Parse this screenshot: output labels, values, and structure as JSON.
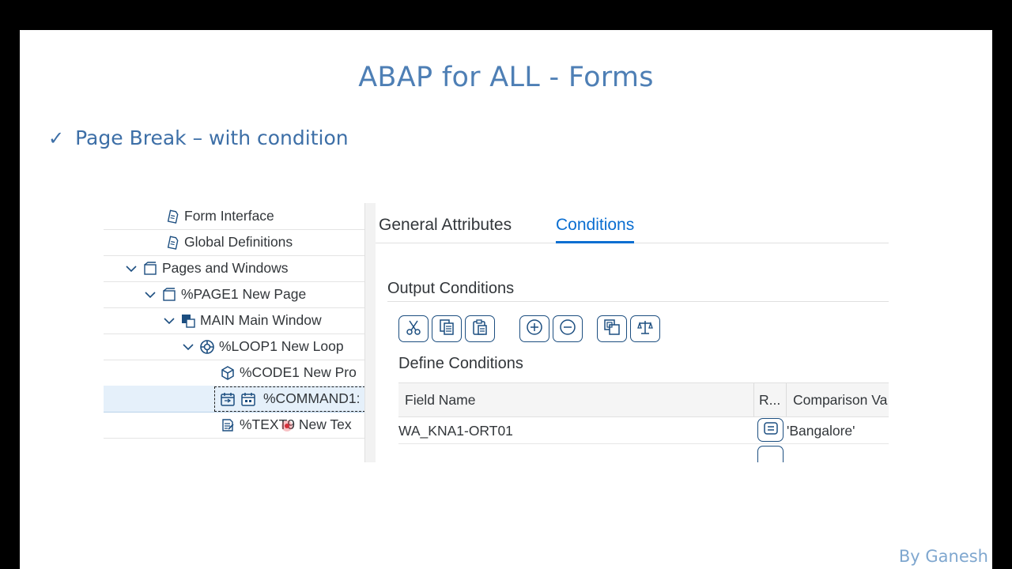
{
  "slide": {
    "title": "ABAP for ALL - Forms",
    "bullet_mark": "✓",
    "bullet_text": "Page Break – with condition",
    "author": "By Ganesh"
  },
  "tree": {
    "items": [
      {
        "label": "Form Interface",
        "icon": "form-interface-icon",
        "expanded": null
      },
      {
        "label": "Global Definitions",
        "icon": "global-definitions-icon",
        "expanded": null
      },
      {
        "label": "Pages and Windows",
        "icon": "pages-windows-icon",
        "expanded": true
      },
      {
        "label": "%PAGE1 New Page",
        "icon": "page-icon",
        "expanded": true
      },
      {
        "label": "MAIN Main Window",
        "icon": "window-icon",
        "expanded": true
      },
      {
        "label": "%LOOP1 New Loop",
        "icon": "loop-icon",
        "expanded": true
      },
      {
        "label": "%CODE1 New Pro",
        "icon": "code-icon",
        "expanded": null
      },
      {
        "label": "%COMMAND1:",
        "icon": "command-icon",
        "expanded": null,
        "selected": true
      },
      {
        "label": "%TEXT9 New Tex",
        "icon": "text-icon",
        "expanded": null
      }
    ]
  },
  "panel": {
    "tabs": [
      {
        "label": "General Attributes",
        "active": false
      },
      {
        "label": "Conditions",
        "active": true
      }
    ],
    "output_conditions_title": "Output Conditions",
    "toolbar": [
      {
        "icon": "cut-icon"
      },
      {
        "icon": "copy-icon"
      },
      {
        "icon": "paste-icon"
      },
      {
        "icon": "add-icon"
      },
      {
        "icon": "remove-icon"
      },
      {
        "icon": "duplicate-icon"
      },
      {
        "icon": "balance-icon"
      }
    ],
    "define_conditions_title": "Define Conditions",
    "grid": {
      "columns": [
        "Field Name",
        "R...",
        "Comparison Va"
      ],
      "rows": [
        {
          "field_name": "WA_KNA1-ORT01",
          "relation_icon": "equals-icon",
          "comparison_value": "'Bangalore'"
        },
        {
          "field_name": "",
          "relation_icon": "",
          "comparison_value": ""
        }
      ]
    }
  },
  "colors": {
    "title": "#4e7fb5",
    "accent": "#0a6ed1",
    "button_border": "#1c4e80",
    "selected_row": "#e5f0fa"
  }
}
